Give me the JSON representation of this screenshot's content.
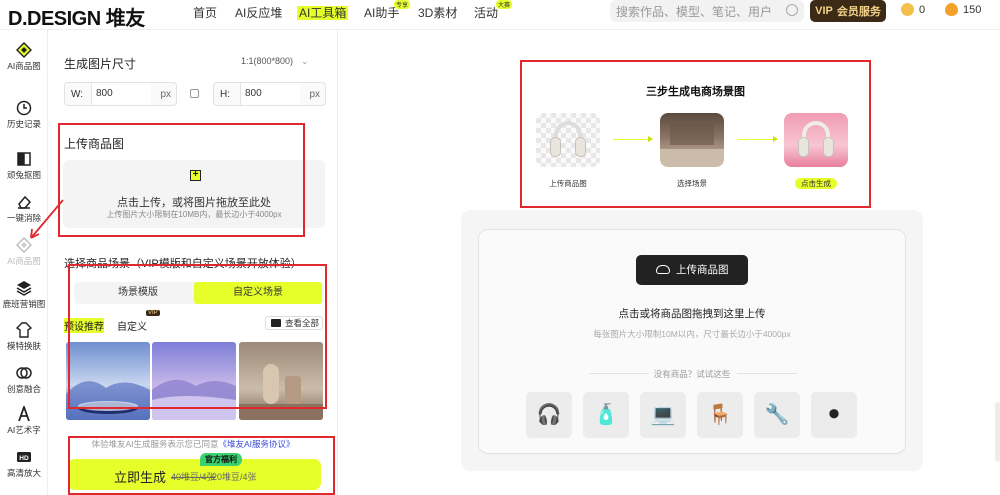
{
  "header": {
    "logo": "D.DESIGN 堆友",
    "nav": [
      {
        "label": "首页",
        "tag": ""
      },
      {
        "label": "AI反应堆",
        "tag": ""
      },
      {
        "label": "AI工具箱",
        "tag": ""
      },
      {
        "label": "AI助手",
        "tag": "专享"
      },
      {
        "label": "3D素材",
        "tag": ""
      },
      {
        "label": "活动",
        "tag": "大赛"
      }
    ],
    "search_placeholder": "搜索作品、模型、笔记、用户",
    "vip_label": "会员服务",
    "vip_badge": "VIP",
    "coins": "0",
    "points": "150"
  },
  "sidebar": {
    "items": [
      {
        "label": "AI商品图",
        "icon": "ai-product-icon"
      },
      {
        "label": "历史记录",
        "icon": "history-icon"
      },
      {
        "label": "顽兔抠图",
        "icon": "cutout-icon"
      },
      {
        "label": "一键消除",
        "icon": "eraser-icon"
      },
      {
        "label": "AI商品图",
        "icon": "ai-product-icon"
      },
      {
        "label": "鹿班营销图",
        "icon": "marketing-icon"
      },
      {
        "label": "模特换肤",
        "icon": "model-icon"
      },
      {
        "label": "创意融合",
        "icon": "fusion-icon"
      },
      {
        "label": "AI艺术字",
        "icon": "art-text-icon"
      },
      {
        "label": "高清放大",
        "icon": "hd-icon"
      }
    ]
  },
  "panel": {
    "size_title": "生成图片尺寸",
    "size_value": "1:1(800*800)",
    "width_label": "W:",
    "width_value": "800",
    "height_label": "H:",
    "height_value": "800",
    "unit": "px",
    "upload_title": "上传商品图",
    "upload_main": "点击上传，或将图片拖放至此处",
    "upload_hint": "上传图片大小限制在10MB内，最长边小于4000px",
    "scene_title": "选择商品场景（VIP模版和自定义场景开放体验）",
    "seg_template": "场景模版",
    "seg_custom": "自定义场景",
    "tab_preset": "预设推荐",
    "tab_custom": "自定义",
    "vip_tag": "VIP",
    "view_all": "查看全部",
    "agreement_prefix": "体验堆友AI生成服务表示您已同意",
    "agreement_link": "《堆友AI服务协议》",
    "generate_label": "立即生成",
    "old_price": "40堆豆/4张",
    "new_price": "20堆豆/4张",
    "perk": "官方福利"
  },
  "steps": {
    "title": "三步生成电商场景图",
    "items": [
      {
        "label": "上传商品图"
      },
      {
        "label": "选择场景"
      },
      {
        "label": "点击生成"
      }
    ]
  },
  "dropzone": {
    "button": "上传商品图",
    "main": "点击或将商品图拖拽到这里上传",
    "hint": "每张图片大小限制10M以内，尺寸最长边小于4000px",
    "try_text": "没有商品？试试这些",
    "samples": [
      {
        "name": "headphones",
        "glyph": "🎧"
      },
      {
        "name": "perfume",
        "glyph": "🧴"
      },
      {
        "name": "laptop",
        "glyph": "💻"
      },
      {
        "name": "chair",
        "glyph": "🪑"
      },
      {
        "name": "drill",
        "glyph": "🔧"
      },
      {
        "name": "tire",
        "glyph": "⚫"
      }
    ]
  },
  "colors": {
    "accent": "#e6ff2b",
    "annotation_red": "#e0282e",
    "vip_brown": "#3a2a16",
    "vip_gold": "#f3d28a"
  }
}
